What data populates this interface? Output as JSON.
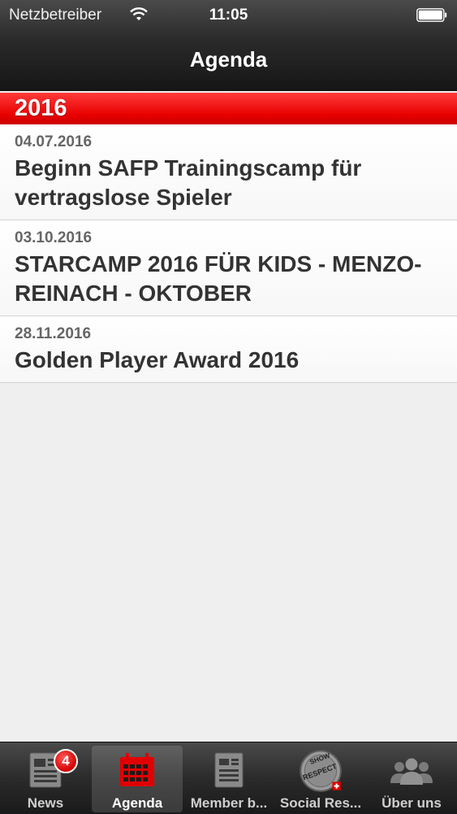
{
  "status_bar": {
    "carrier": "Netzbetreiber",
    "time": "11:05",
    "icons": [
      "wifi-icon",
      "battery-icon"
    ]
  },
  "nav": {
    "title": "Agenda"
  },
  "section": {
    "header": "2016"
  },
  "events": [
    {
      "date": "04.07.2016",
      "title": "Beginn SAFP Trainingscamp für vertragslose Spieler"
    },
    {
      "date": "03.10.2016",
      "title": "STARCAMP 2016 FÜR KIDS - MENZO-REINACH - OKTOBER"
    },
    {
      "date": "28.11.2016",
      "title": "Golden Player Award 2016"
    }
  ],
  "tabs": [
    {
      "label": "News",
      "icon": "newspaper-icon",
      "badge": "4"
    },
    {
      "label": "Agenda",
      "icon": "calendar-icon",
      "active": true
    },
    {
      "label": "Member b...",
      "icon": "document-icon"
    },
    {
      "label": "Social Res...",
      "icon": "show-respect-icon",
      "icon_text": [
        "SHOW",
        "RESPECT"
      ]
    },
    {
      "label": "Über uns",
      "icon": "people-icon"
    }
  ],
  "colors": {
    "accent": "#e80000",
    "tab_active_calendar": "#e00000"
  }
}
